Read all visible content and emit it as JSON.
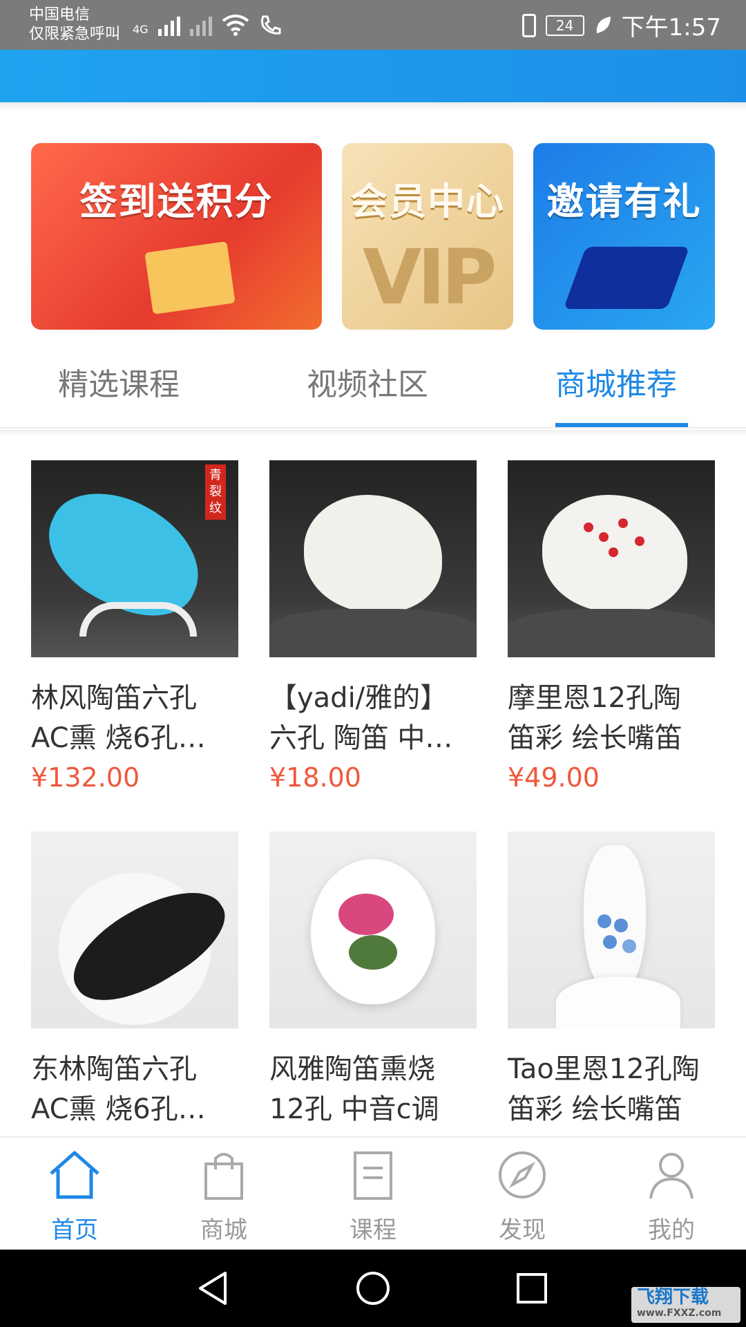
{
  "status_bar": {
    "carrier_line1": "中国电信",
    "carrier_line2": "仅限紧急呼叫",
    "network": "4G",
    "battery": "24",
    "time": "下午1:57",
    "icons": [
      "signal-icon",
      "no-signal-icon",
      "wifi-icon",
      "call-icon",
      "vibrate-icon",
      "battery-icon",
      "leaf-icon"
    ]
  },
  "banners": [
    {
      "label": "签到送积分",
      "icon": "calendar-gift-illustration"
    },
    {
      "label": "会员中心",
      "decor": "VIP"
    },
    {
      "label": "邀请有礼",
      "icon": "isometric-phone-illustration"
    }
  ],
  "tabs": [
    {
      "label": "精选课程",
      "active": false
    },
    {
      "label": "视频社区",
      "active": false
    },
    {
      "label": "商城推荐",
      "active": true
    }
  ],
  "products": [
    {
      "title": "林风陶笛六孔\nAC熏 烧6孔…",
      "price": "¥132.00",
      "stamp": "青裂纹"
    },
    {
      "title": "【yadi/雅的】\n六孔 陶笛 中…",
      "price": "¥18.00"
    },
    {
      "title": "摩里恩12孔陶\n笛彩 绘长嘴笛",
      "price": "¥49.00"
    },
    {
      "title": "东林陶笛六孔\nAC熏 烧6孔…",
      "price": ""
    },
    {
      "title": "风雅陶笛熏烧\n12孔 中音c调",
      "price": ""
    },
    {
      "title": "Tao里恩12孔陶\n笛彩 绘长嘴笛",
      "price": ""
    }
  ],
  "bottom_nav": [
    {
      "label": "首页",
      "icon": "home-icon",
      "active": true
    },
    {
      "label": "商城",
      "icon": "shopping-bag-icon",
      "active": false
    },
    {
      "label": "课程",
      "icon": "document-icon",
      "active": false
    },
    {
      "label": "发现",
      "icon": "compass-icon",
      "active": false
    },
    {
      "label": "我的",
      "icon": "user-icon",
      "active": false
    }
  ],
  "colors": {
    "accent": "#1e88e5",
    "price": "#f0573c",
    "header": "#1d8fe8"
  },
  "watermark": {
    "title": "飞翔下载",
    "url": "www.FXXZ.com"
  }
}
